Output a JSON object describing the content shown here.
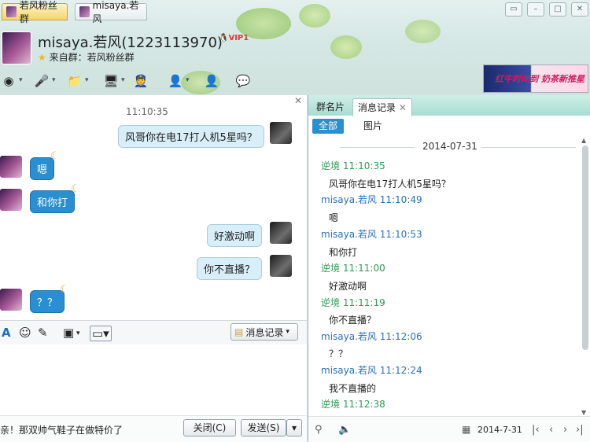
{
  "tabs": [
    {
      "label": "若风粉丝群"
    },
    {
      "label": "misaya.若风"
    }
  ],
  "header": {
    "name": "misaya.若风(1223113970)",
    "vip": "VIP1",
    "source": "来自群：若风粉丝群"
  },
  "ad": {
    "text": "红牛时间到 奶茶新推星"
  },
  "chat": {
    "timestamp": "11:10:35",
    "messages": [
      {
        "side": "right",
        "text": "风哥你在电17打人机5星吗？"
      },
      {
        "side": "left",
        "text": "嗯"
      },
      {
        "side": "left",
        "text": "和你打"
      },
      {
        "side": "right",
        "text": "好激动啊"
      },
      {
        "side": "right",
        "text": "你不直播？"
      },
      {
        "side": "left",
        "text": "？？"
      }
    ]
  },
  "toolbar": {
    "history_label": "消息记录"
  },
  "input": {
    "marquee": "亲！那双帅气鞋子在做特价了"
  },
  "buttons": {
    "close": "关闭(C)",
    "send": "发送(S)"
  },
  "panel": {
    "tabs": [
      "群名片",
      "消息记录"
    ],
    "filter_all": "全部",
    "filter_pic": "图片",
    "date": "2014-07-31",
    "history": [
      {
        "sender": "逆境",
        "time": "11:10:35",
        "text": "风哥你在电17打人机5星吗？"
      },
      {
        "sender": "misaya.若风",
        "time": "11:10:49",
        "text": "嗯"
      },
      {
        "sender": "misaya.若风",
        "time": "11:10:53",
        "text": "和你打"
      },
      {
        "sender": "逆境",
        "time": "11:11:00",
        "text": "好激动啊"
      },
      {
        "sender": "逆境",
        "time": "11:11:19",
        "text": "你不直播？"
      },
      {
        "sender": "misaya.若风",
        "time": "11:12:06",
        "text": "？？"
      },
      {
        "sender": "misaya.若风",
        "time": "11:12:24",
        "text": "我不直播的"
      },
      {
        "sender": "逆境",
        "time": "11:12:38",
        "text": ""
      }
    ],
    "footer_date": "2014-7-31"
  },
  "colors": {
    "accent": "#2a8fd0",
    "green": "#2e9c57",
    "blue": "#2a6fc4"
  }
}
